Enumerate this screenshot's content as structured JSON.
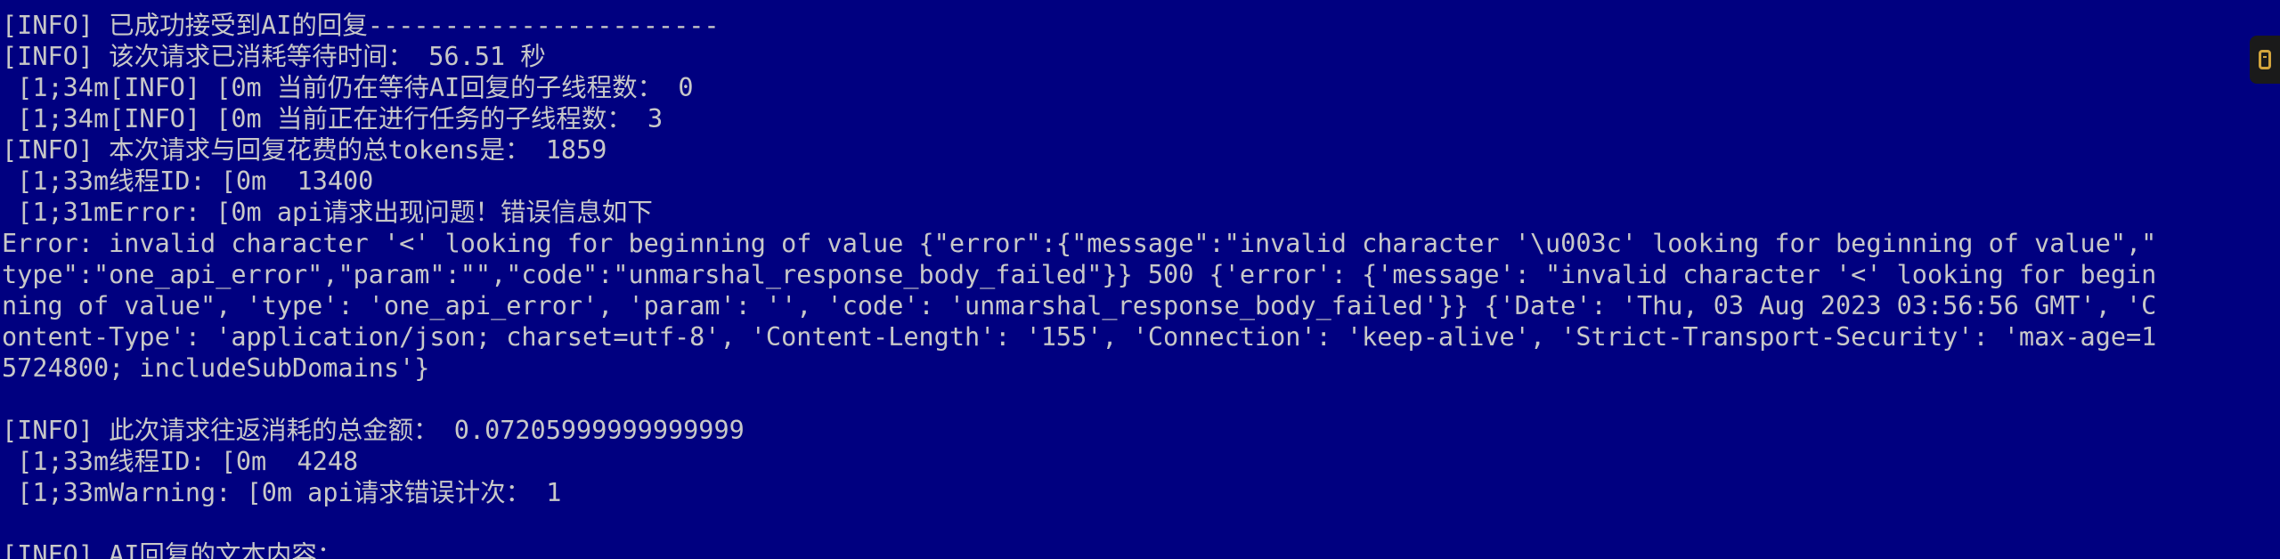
{
  "console": {
    "lines": [
      "[INFO] 已成功接受到AI的回复-----------------------",
      "[INFO] 该次请求已消耗等待时间： 56.51 秒",
      " [1;34m[INFO] [0m 当前仍在等待AI回复的子线程数： 0",
      " [1;34m[INFO] [0m 当前正在进行任务的子线程数： 3",
      "[INFO] 本次请求与回复花费的总tokens是： 1859",
      " [1;33m线程ID: [0m  13400",
      " [1;31mError: [0m api请求出现问题！错误信息如下",
      "Error: invalid character '<' looking for beginning of value {\"error\":{\"message\":\"invalid character '\\u003c' looking for beginning of value\",\"",
      "type\":\"one_api_error\",\"param\":\"\",\"code\":\"unmarshal_response_body_failed\"}} 500 {'error': {'message': \"invalid character '<' looking for begin",
      "ning of value\", 'type': 'one_api_error', 'param': '', 'code': 'unmarshal_response_body_failed'}} {'Date': 'Thu, 03 Aug 2023 03:56:56 GMT', 'C",
      "ontent-Type': 'application/json; charset=utf-8', 'Content-Length': '155', 'Connection': 'keep-alive', 'Strict-Transport-Security': 'max-age=1",
      "5724800; includeSubDomains'}",
      "",
      "[INFO] 此次请求往返消耗的总金额： 0.07205999999999999",
      " [1;33m线程ID: [0m  4248",
      " [1;33mWarning: [0m api请求错误计次： 1",
      "",
      "[INFO] AI回复的文本内容："
    ]
  },
  "colors": {
    "background": "#000080",
    "foreground": "#c8c8c8",
    "tab_icon": "#d2a43c"
  },
  "icons": {
    "scroll_tab": "window-tab-icon"
  }
}
